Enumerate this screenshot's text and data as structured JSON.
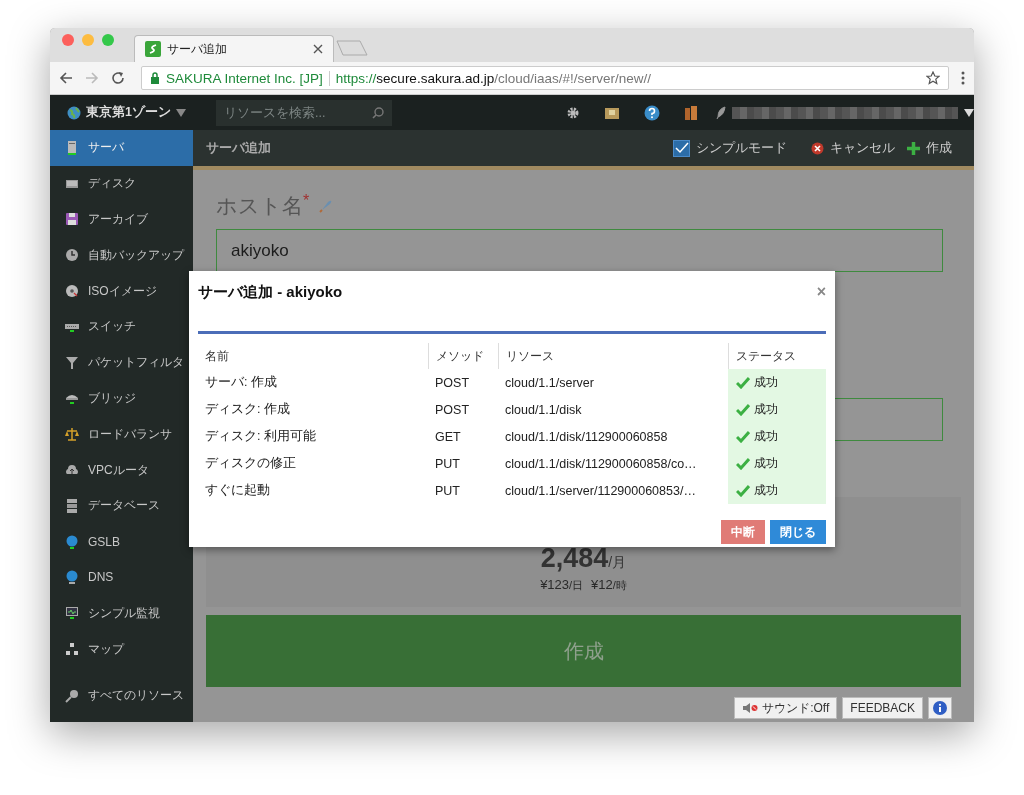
{
  "browser": {
    "tab_title": "サーバ追加",
    "security_label": "SAKURA Internet Inc. [JP]",
    "url": {
      "scheme": "https://",
      "host": "secure.sakura.ad.jp",
      "path": "/cloud/iaas/#!/server/new//"
    }
  },
  "topbar": {
    "zone": "東京第1ゾーン",
    "search": {
      "placeholder": "リソースを検索..."
    }
  },
  "sidebar": {
    "items": [
      {
        "label": "サーバ",
        "selected": true
      },
      {
        "label": "ディスク",
        "selected": false
      },
      {
        "label": "アーカイブ",
        "selected": false
      },
      {
        "label": "自動バックアップ",
        "selected": false
      },
      {
        "label": "ISOイメージ",
        "selected": false
      },
      {
        "label": "スイッチ",
        "selected": false
      },
      {
        "label": "パケットフィルタ",
        "selected": false
      },
      {
        "label": "ブリッジ",
        "selected": false
      },
      {
        "label": "ロードバランサ",
        "selected": false
      },
      {
        "label": "VPCルータ",
        "selected": false
      },
      {
        "label": "データベース",
        "selected": false
      },
      {
        "label": "GSLB",
        "selected": false
      },
      {
        "label": "DNS",
        "selected": false
      },
      {
        "label": "シンプル監視",
        "selected": false
      },
      {
        "label": "マップ",
        "selected": false
      },
      {
        "label": "すべてのリソース",
        "selected": false
      }
    ]
  },
  "subheader": {
    "title": "サーバ追加",
    "simple_mode": {
      "label": "シンプルモード",
      "checked": true
    },
    "cancel": "キャンセル",
    "create": "作成"
  },
  "form": {
    "host_label": "ホスト名",
    "required_mark": "*",
    "host_value": "akiyoko",
    "price": "2,484",
    "price_unit": "/月",
    "daily": "¥123",
    "daily_unit": "/日",
    "hourly": "¥12",
    "hourly_unit": "/時",
    "create_button": "作成"
  },
  "dialog": {
    "title": "サーバ追加 - akiyoko",
    "close": "×",
    "columns": [
      "名前",
      "メソッド",
      "リソース",
      "ステータス"
    ],
    "rows": [
      {
        "name": "サーバ: 作成",
        "method": "POST",
        "resource": "cloud/1.1/server",
        "status": "成功",
        "kind": "success"
      },
      {
        "name": "ディスク: 作成",
        "method": "POST",
        "resource": "cloud/1.1/disk",
        "status": "成功",
        "kind": "success"
      },
      {
        "name": "ディスク: 利用可能",
        "method": "GET",
        "resource": "cloud/1.1/disk/112900060858",
        "status": "成功",
        "kind": "success"
      },
      {
        "name": "ディスクの修正",
        "method": "PUT",
        "resource": "cloud/1.1/disk/112900060858/co…",
        "status": "成功",
        "kind": "success"
      },
      {
        "name": "すぐに起動",
        "method": "PUT",
        "resource": "cloud/1.1/server/112900060853/…",
        "status": "成功",
        "kind": "success"
      }
    ],
    "buttons": [
      {
        "label": "中断",
        "kind": "danger"
      },
      {
        "label": "閉じる",
        "kind": "primary"
      }
    ]
  },
  "footer": {
    "sound": "サウンド:Off",
    "feedback": "FEEDBACK"
  }
}
